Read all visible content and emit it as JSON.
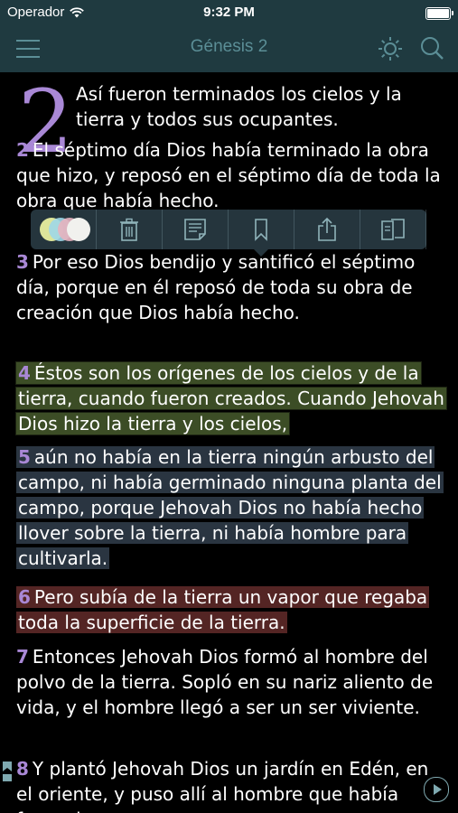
{
  "status": {
    "carrier": "Operador",
    "time": "9:32 PM"
  },
  "nav": {
    "title": "Génesis 2",
    "icons": [
      "menu-icon",
      "brightness-icon",
      "search-icon"
    ]
  },
  "chapter": {
    "number": "2"
  },
  "verses": [
    {
      "num": "",
      "text": "Así fueron terminados los cielos y la tierra y todos sus ocupantes."
    },
    {
      "num": "2",
      "text": "El séptimo día Dios había terminado la obra que hizo, y reposó en el séptimo día de toda la obra que había hecho."
    },
    {
      "num": "3",
      "text": "Por eso Dios bendijo y santificó el séptimo día, porque en él reposó de toda su obra de creación que Dios había hecho."
    },
    {
      "num": "4",
      "text": "Éstos son los orígenes de los cielos y de la tierra, cuando fueron creados. Cuando Jehovah Dios hizo la tierra y los cielos,",
      "highlight": "green"
    },
    {
      "num": "5",
      "text": "aún no había en la tierra ningún arbusto del campo, ni había germinado ninguna planta del campo, porque Jehovah Dios no había hecho llover sobre la tierra, ni había hombre para cultivarla.",
      "highlight": "blue"
    },
    {
      "num": "6",
      "text": "Pero subía de la tierra un vapor que regaba toda la superficie de la tierra.",
      "highlight": "red"
    },
    {
      "num": "7",
      "text": "Entonces Jehovah Dios formó al hombre del polvo de la tierra. Sopló en su nariz aliento de vida, y el hombre llegó a ser un ser viviente."
    },
    {
      "num": "8",
      "text": "Y plantó Jehovah Dios un jardín en Edén, en el oriente, y puso allí al hombre que había formado."
    }
  ],
  "toolbar": {
    "items": [
      "highlight-colors",
      "delete",
      "note",
      "bookmark",
      "share",
      "copy"
    ]
  },
  "colors": {
    "bar": "#1f3a40",
    "nav_text": "#5b8e96",
    "verse_number": "#a988d6",
    "highlight_green": "#6e8c46",
    "highlight_blue": "#46586c",
    "highlight_red": "#8c3e3c"
  }
}
